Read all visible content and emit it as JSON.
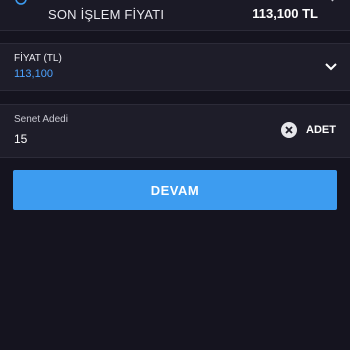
{
  "last_trade": {
    "label": "SON İŞLEM FİYATI",
    "value": "113,100 TL"
  },
  "price_field": {
    "label": "FİYAT (TL)",
    "value": "113,100"
  },
  "quantity_field": {
    "label": "Senet Adedi",
    "value": "15",
    "unit": "ADET"
  },
  "actions": {
    "continue_label": "DEVAM"
  },
  "colors": {
    "background": "#15141f",
    "accent": "#3d9cf0",
    "price_text": "#4da3ff"
  },
  "icons": [
    "refresh-icon",
    "chevron-right-icon",
    "chevron-down-icon",
    "clear-icon"
  ]
}
